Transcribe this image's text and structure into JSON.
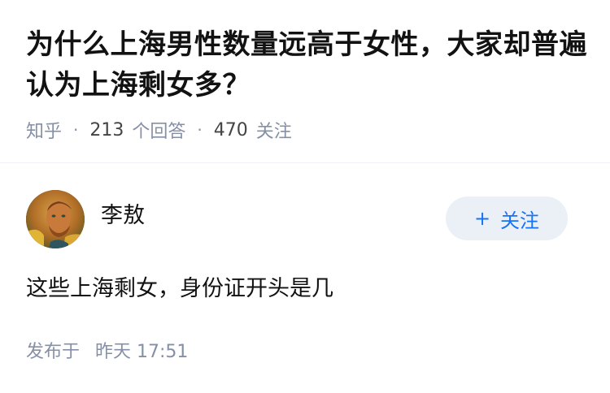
{
  "question": {
    "title": "为什么上海男性数量远高于女性，大家却普遍认为上海剩女多？",
    "source": "知乎",
    "answers_count": "213",
    "answers_label": "个回答",
    "followers_count": "470",
    "followers_label": "关注"
  },
  "answer": {
    "author_name": "李敖",
    "follow_button_label": "关注",
    "follow_icon": "+",
    "content": "这些上海剩女，身份证开头是几",
    "published_prefix": "发布于",
    "published_time": "昨天 17:51"
  },
  "colors": {
    "title": "#121212",
    "meta": "#8590a6",
    "accent": "#1772f6",
    "follow_bg": "#ebf0f7",
    "divider": "#f0f2f7"
  }
}
